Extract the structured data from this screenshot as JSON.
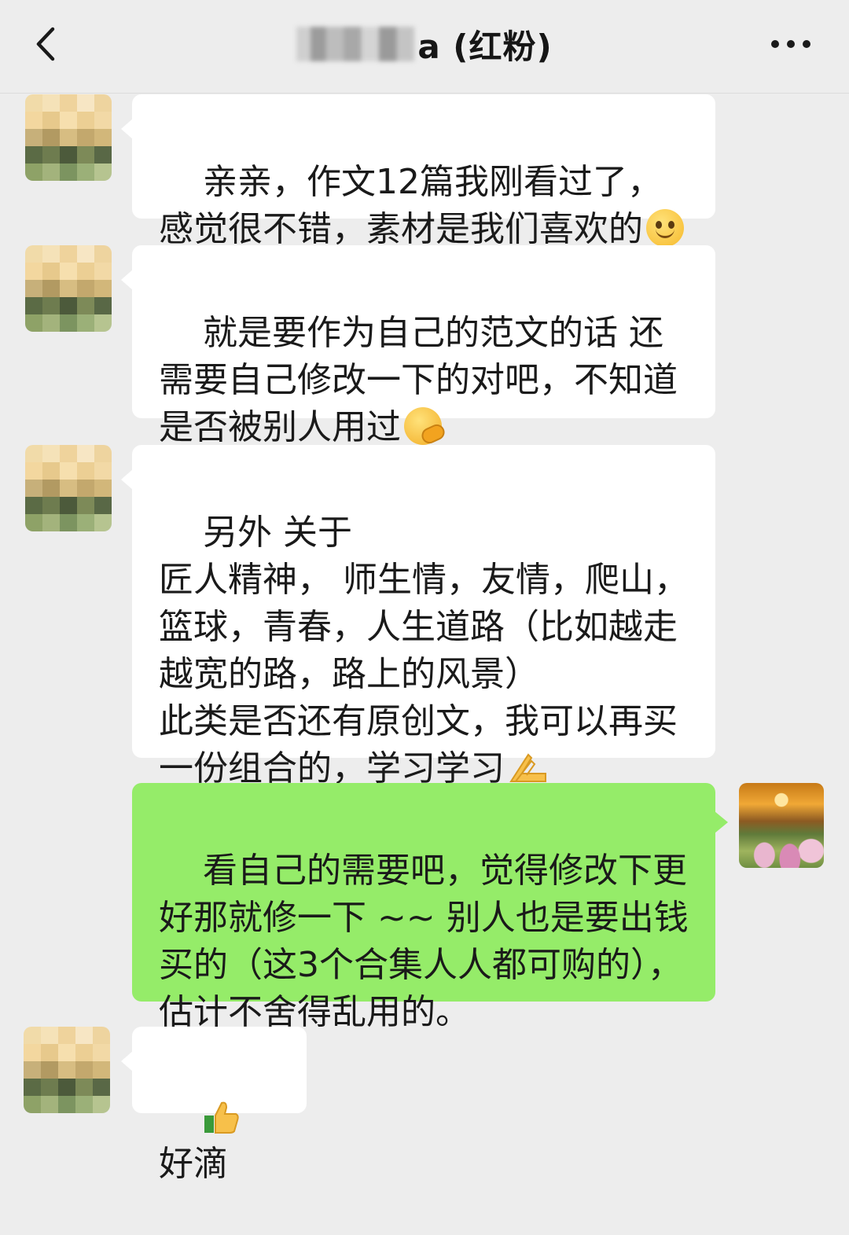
{
  "header": {
    "title": "a (红粉)",
    "back_icon": "chevron-left-icon",
    "more_icon": "more-dots-icon"
  },
  "messages": [
    {
      "side": "left",
      "text": "亲亲，作文12篇我刚看过了，感觉很不错，素材是我们喜欢的",
      "emoji": "smile-emoji"
    },
    {
      "side": "left",
      "text": "就是要作为自己的范文的话 还需要自己修改一下的对吧，不知道是否被别人用过",
      "emoji": "thinking-emoji"
    },
    {
      "side": "left",
      "text": "另外 关于\n匠人精神， 师生情，友情，爬山，篮球，青春，人生道路（比如越走越宽的路，路上的风景）\n此类是否还有原创文，我可以再买一份组合的，学习学习",
      "emoji": "pray-emoji"
    },
    {
      "side": "right",
      "text": "看自己的需要吧，觉得修改下更好那就修一下 ~~ 别人也是要出钱买的（这3个合集人人都可购的），估计不舍得乱用的。"
    },
    {
      "side": "left",
      "text": "好滴",
      "emoji": "thumbs-up-emoji"
    }
  ],
  "colors": {
    "background": "#ededed",
    "bubble_other": "#ffffff",
    "bubble_self": "#95ec69"
  }
}
